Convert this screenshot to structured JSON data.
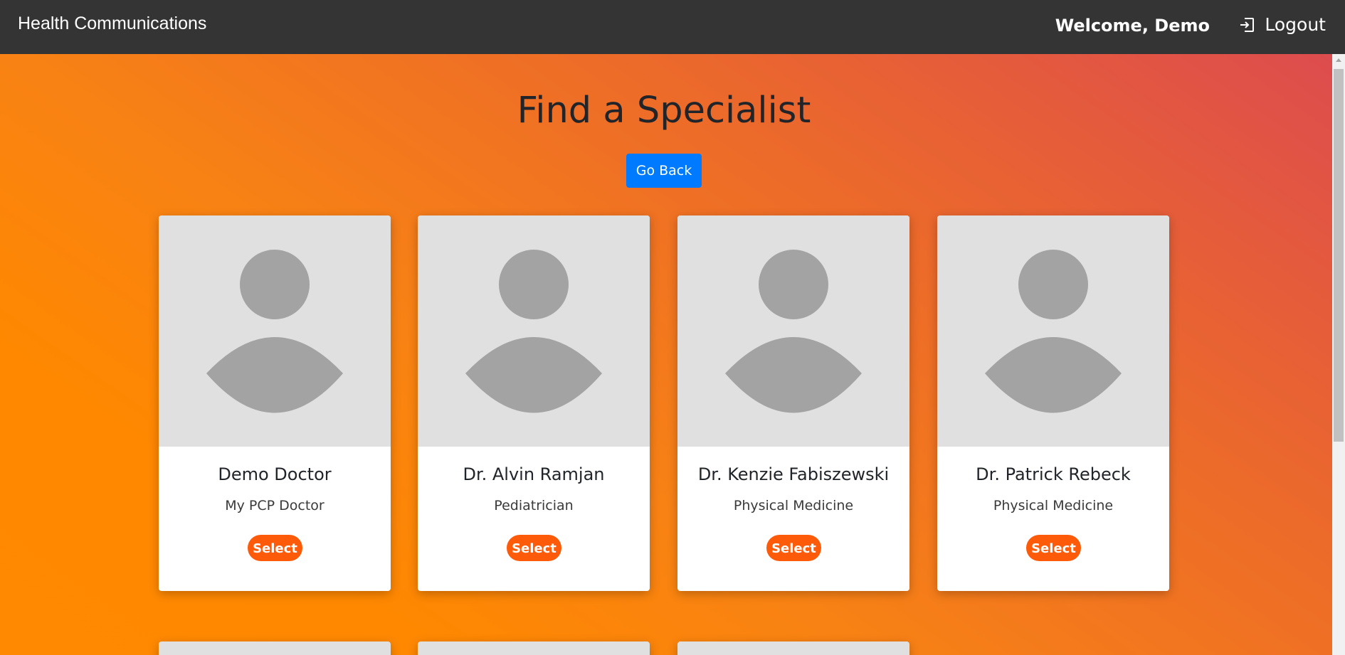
{
  "header": {
    "brand": "Health Communications",
    "welcome": "Welcome, Demo",
    "logout_label": "Logout",
    "background": "#343434"
  },
  "main": {
    "title": "Find a Specialist",
    "go_back_label": "Go Back",
    "doctors": [
      {
        "name": "Demo Doctor",
        "specialty": "My PCP Doctor",
        "select_label": "Select"
      },
      {
        "name": "Dr. Alvin Ramjan",
        "specialty": "Pediatrician",
        "select_label": "Select"
      },
      {
        "name": "Dr. Kenzie Fabiszewski",
        "specialty": "Physical Medicine",
        "select_label": "Select"
      },
      {
        "name": "Dr. Patrick Rebeck",
        "specialty": "Physical Medicine",
        "select_label": "Select"
      }
    ]
  },
  "colors": {
    "accent": "#007bff",
    "select_button": "#fd5a09",
    "gradient_start": "#ff8900",
    "gradient_end": "#dd4c4e",
    "avatar_placeholder": "#e0e0e0",
    "avatar_silhouette": "#a3a3a3"
  },
  "icons": {
    "logout": "logout-icon",
    "avatar": "avatar-placeholder-icon"
  }
}
